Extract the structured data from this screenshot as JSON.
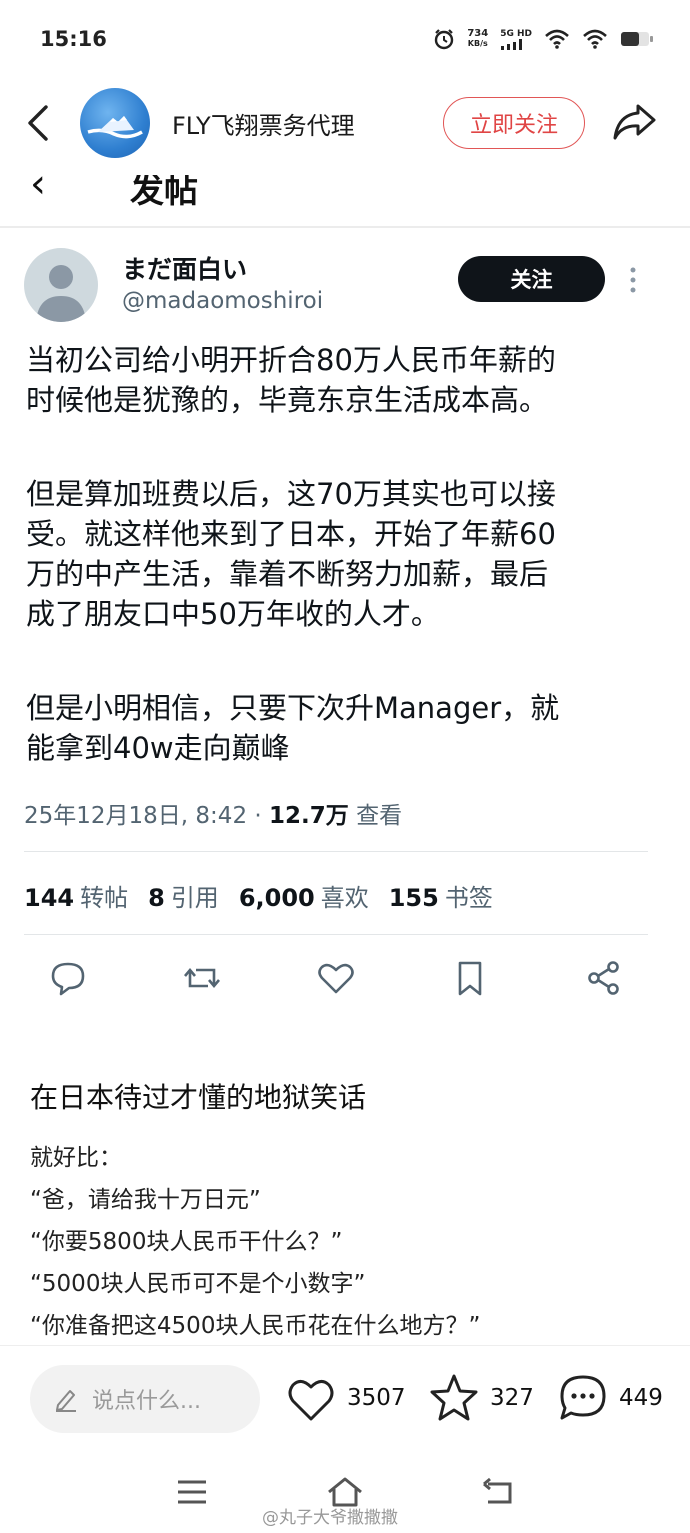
{
  "status_bar": {
    "time": "15:16",
    "net_speed_value": "734",
    "net_speed_unit": "KB/s",
    "network": "5G HD"
  },
  "header": {
    "account_name": "FLY飞翔票务代理",
    "follow_label": "立即关注"
  },
  "cut_off_title": "发帖",
  "tweet": {
    "display_name": "まだ面白い",
    "handle": "@madaomoshiroi",
    "follow_label": "关注",
    "paragraphs": [
      [
        "当初公司给小明开折合80万人民币年薪的",
        "时候他是犹豫的，毕竟东京生活成本高。"
      ],
      [
        "但是算加班费以后，这70万其实也可以接",
        "受。就这样他来到了日本，开始了年薪60",
        "万的中产生活，靠着不断努力加薪，最后",
        "成了朋友口中50万年收的人才。"
      ],
      [
        "但是小明相信，只要下次升Manager，就",
        "能拿到40w走向巅峰"
      ]
    ],
    "date_time": "25年12月18日, 8:42",
    "views_count": "12.7万",
    "views_label": "查看",
    "stats": [
      {
        "count": "144",
        "label": "转帖"
      },
      {
        "count": "8",
        "label": "引用"
      },
      {
        "count": "6,000",
        "label": "喜欢"
      },
      {
        "count": "155",
        "label": "书签"
      }
    ]
  },
  "post": {
    "title": "在日本待过才懂的地狱笑话",
    "lines": [
      "就好比：",
      "“爸，请给我十万日元”",
      "“你要5800块人民币干什么？”",
      "“5000块人民币可不是个小数字”",
      "“你准备把这4500块人民币花在什么地方？”"
    ]
  },
  "bottom_bar": {
    "comment_placeholder": "说点什么...",
    "likes": "3507",
    "favorites": "327",
    "comments": "449"
  },
  "watermark": "@丸子大爷撒撒撒"
}
